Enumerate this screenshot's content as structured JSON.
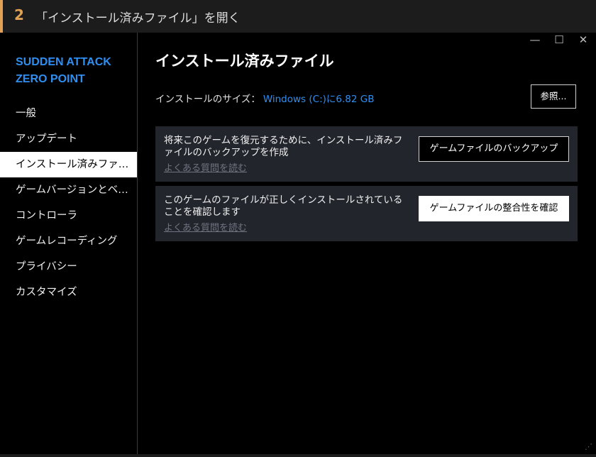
{
  "step": {
    "number": "2",
    "text": "「インストール済みファイル」を開く"
  },
  "window_controls": {
    "minimize": "—",
    "maximize": "☐",
    "close": "✕"
  },
  "sidebar": {
    "game_title": "SUDDEN ATTACK ZERO POINT",
    "items": [
      {
        "label": "一般"
      },
      {
        "label": "アップデート"
      },
      {
        "label": "インストール済みファ…"
      },
      {
        "label": "ゲームバージョンとベ…"
      },
      {
        "label": "コントローラ"
      },
      {
        "label": "ゲームレコーディング"
      },
      {
        "label": "プライバシー"
      },
      {
        "label": "カスタマイズ"
      }
    ],
    "active_index": 2
  },
  "main": {
    "title": "インストール済みファイル",
    "size_label": "インストールのサイズ：",
    "size_value": "Windows (C:)に6.82 GB",
    "browse_label": "参照...",
    "cards": [
      {
        "description": "将来このゲームを復元するために、インストール済みファイルのバックアップを作成",
        "link": "よくある質問を読む",
        "button": "ゲームファイルのバックアップ"
      },
      {
        "description": "このゲームのファイルが正しくインストールされていることを確認します",
        "link": "よくある質問を読む",
        "button": "ゲームファイルの整合性を確認"
      }
    ]
  },
  "colors": {
    "accent": "#2f8ff0",
    "step_accent": "#e0a055",
    "card_bg": "#22252c"
  }
}
